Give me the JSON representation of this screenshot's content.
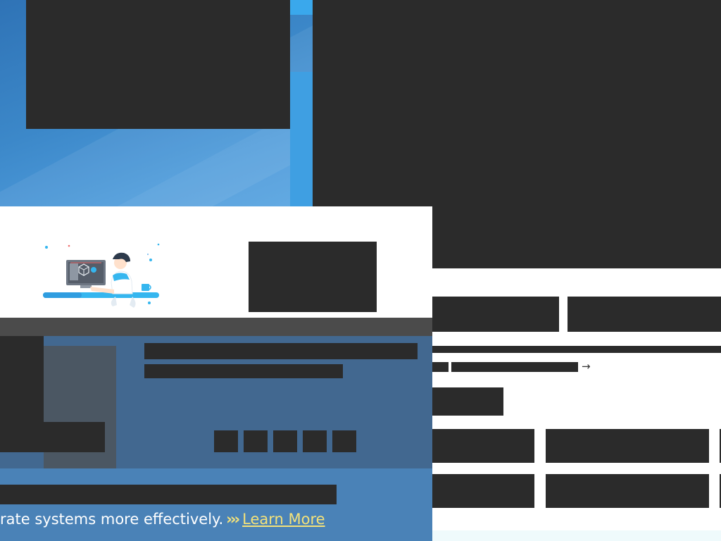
{
  "banner": {
    "text": "rate systems more effectively.",
    "chevrons": "›››",
    "link_label": "Learn More"
  },
  "right": {
    "link_arrow": "→"
  },
  "colors": {
    "wallpaper_blue": "#3c88c9",
    "banner_blue": "#4a82b7",
    "link_yellow": "#f4e27a",
    "redaction": "#2b2b2b"
  },
  "icons": {
    "promo_illustration": "person-at-computer-illustration",
    "arrow": "arrow-right-icon"
  }
}
